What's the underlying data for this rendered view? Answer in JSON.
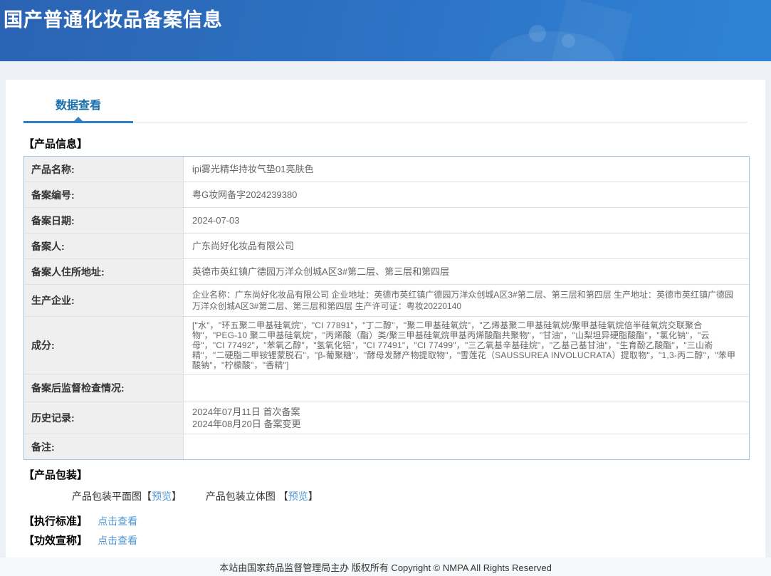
{
  "colors": {
    "header_gradient_from": "#2b63b3",
    "header_gradient_to": "#2f83d6",
    "tab_accent": "#2e7fc6",
    "tab_text": "#1b6fad",
    "link_blue": "#4f97d6",
    "table_border": "#a7c3df",
    "label_bg": "#efefef"
  },
  "header": {
    "title": "国产普通化妆品备案信息"
  },
  "tabs": {
    "data_view": "数据查看"
  },
  "sections": {
    "product_info": "【产品信息】",
    "packaging": "【产品包装】",
    "standard": "【执行标准】",
    "efficacy": "【功效宣称】"
  },
  "product_table": {
    "rows": [
      {
        "label": "产品名称:",
        "value": "ipi雾光精华持妆气垫01亮肤色"
      },
      {
        "label": "备案编号:",
        "value": "粤G妆网备字2024239380"
      },
      {
        "label": "备案日期:",
        "value": "2024-07-03"
      },
      {
        "label": "备案人:",
        "value": "广东尚好化妆品有限公司"
      },
      {
        "label": "备案人住所地址:",
        "value": "英德市英红镇广德园万洋众创城A区3#第二层、第三层和第四层"
      },
      {
        "label": "生产企业:",
        "value": "企业名称：广东尚好化妆品有限公司 企业地址：英德市英红镇广德园万洋众创城A区3#第二层、第三层和第四层 生产地址：英德市英红镇广德园万洋众创城A区3#第二层、第三层和第四层 生产许可证：粤妆20220140"
      },
      {
        "label": "成分:",
        "value": "[\"水\"，\"环五聚二甲基硅氧烷\"，\"CI 77891\"，\"丁二醇\"，\"聚二甲基硅氧烷\"，\"乙烯基聚二甲基硅氧烷/聚甲基硅氧烷倍半硅氧烷交联聚合物\"，\"PEG-10 聚二甲基硅氧烷\"，\"丙烯酸（酯）类/聚三甲基硅氧烷甲基丙烯酸酯共聚物\"，\"甘油\"，\"山梨坦异硬脂酸酯\"，\"氯化钠\"，\"云母\"，\"CI 77492\"，\"苯氧乙醇\"，\"氢氧化铝\"，\"CI 77491\"，\"CI 77499\"，\"三乙氧基辛基硅烷\"，\"乙基己基甘油\"，\"生育酚乙酸酯\"，\"三山嵛精\"，\"二硬脂二甲铵锂蒙脱石\"，\"β-葡聚糖\"，\"酵母发酵产物提取物\"，\"雪莲花（SAUSSUREA INVOLUCRATA）提取物\"，\"1,3-丙二醇\"，\"苯甲酸钠\"，\"柠檬酸\"，\"香精\"]"
      },
      {
        "label": "备案后监督检查情况:",
        "value": ""
      },
      {
        "label": "历史记录:",
        "lines": [
          "2024年07月11日 首次备案",
          "2024年08月20日 备案变更"
        ]
      },
      {
        "label": "备注:",
        "value": ""
      }
    ]
  },
  "packaging": {
    "items": [
      {
        "label": "产品包装平面图",
        "open": "【",
        "link": "预览",
        "close": "】"
      },
      {
        "label": "产品包装立体图 ",
        "open": "【",
        "link": "预览",
        "close": "】"
      }
    ]
  },
  "standard": {
    "link": "点击查看"
  },
  "efficacy": {
    "link": "点击查看"
  },
  "footer": {
    "text": "本站由国家药品监督管理局主办 版权所有 Copyright © NMPA All Rights Reserved"
  }
}
